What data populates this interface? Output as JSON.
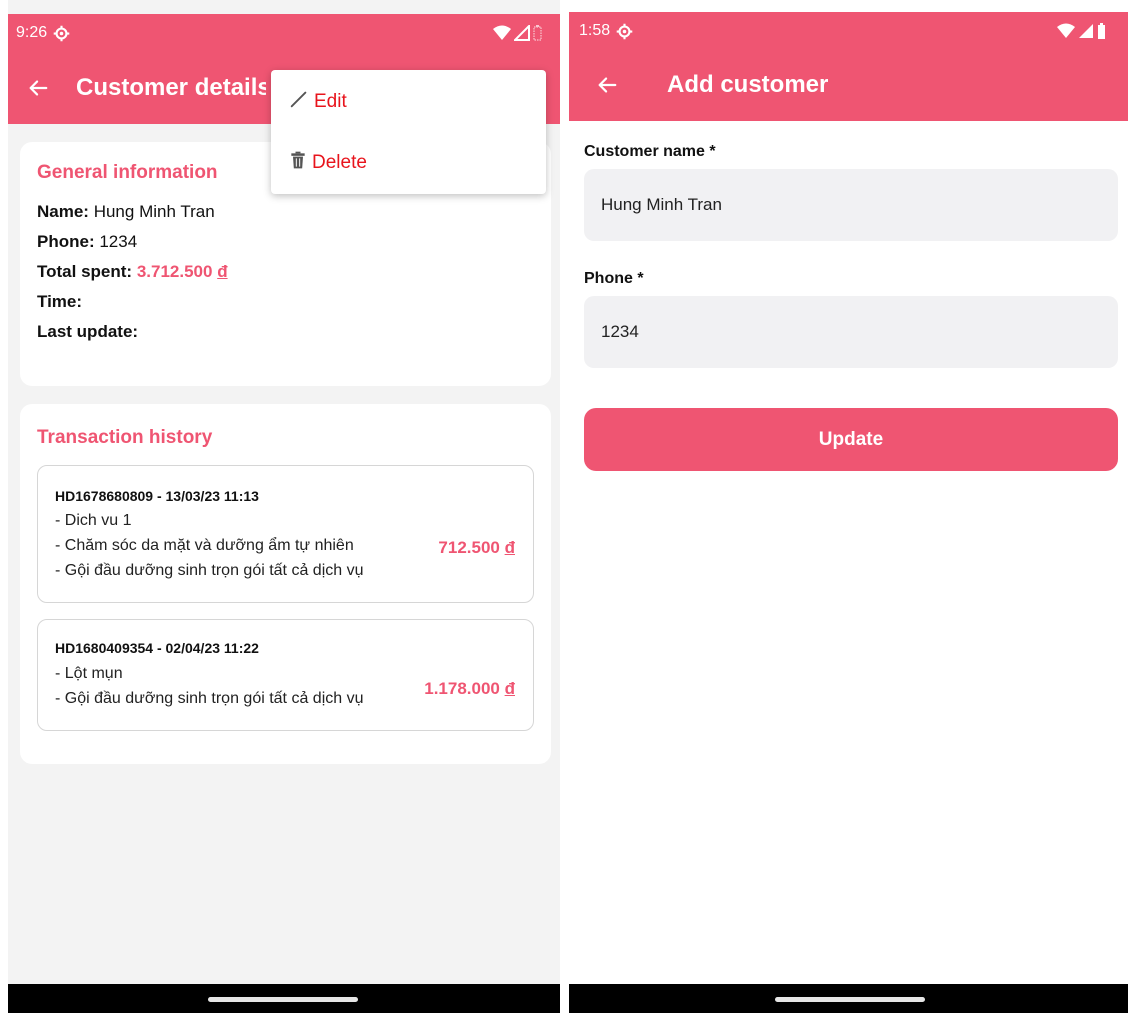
{
  "left_screen": {
    "status_bar": {
      "time": "9:26"
    },
    "app_bar": {
      "title": "Customer details"
    },
    "overflow_menu": {
      "items": [
        "Edit",
        "Delete"
      ]
    },
    "general_info": {
      "title": "General information",
      "name_label": "Name:",
      "name_value": "Hung Minh Tran",
      "phone_label": "Phone:",
      "phone_value": "1234",
      "total_label": "Total spent:",
      "total_value": "3.712.500",
      "currency": "đ",
      "time_label": "Time:",
      "last_update_label": "Last update:"
    },
    "transactions": {
      "title": "Transaction history",
      "items": [
        {
          "header": "HD1678680809 - 13/03/23 11:13",
          "lines": [
            "- Dich vu 1",
            "- Chăm sóc da mặt và dưỡng ẩm tự nhiên",
            "- Gội đầu dưỡng sinh trọn gói tất cả dịch vụ"
          ],
          "amount": "712.500",
          "currency": "đ"
        },
        {
          "header": "HD1680409354 - 02/04/23 11:22",
          "lines": [
            "- Lột mụn",
            "- Gội đầu dưỡng sinh trọn gói tất cả dịch vụ"
          ],
          "amount": "1.178.000",
          "currency": "đ"
        }
      ]
    }
  },
  "right_screen": {
    "status_bar": {
      "time": "1:58"
    },
    "app_bar": {
      "title": "Add customer"
    },
    "form": {
      "name_label": "Customer name *",
      "name_value": "Hung Minh Tran",
      "phone_label": "Phone *",
      "phone_value": "1234",
      "submit_label": "Update"
    }
  },
  "colors": {
    "accent": "#ef5572",
    "menu_text": "#e8141c",
    "background": "#f3f3f3"
  },
  "icons": [
    "back-arrow-icon",
    "settings-gear-icon",
    "wifi-icon",
    "signal-icon",
    "battery-icon",
    "pencil-icon",
    "trash-icon"
  ]
}
